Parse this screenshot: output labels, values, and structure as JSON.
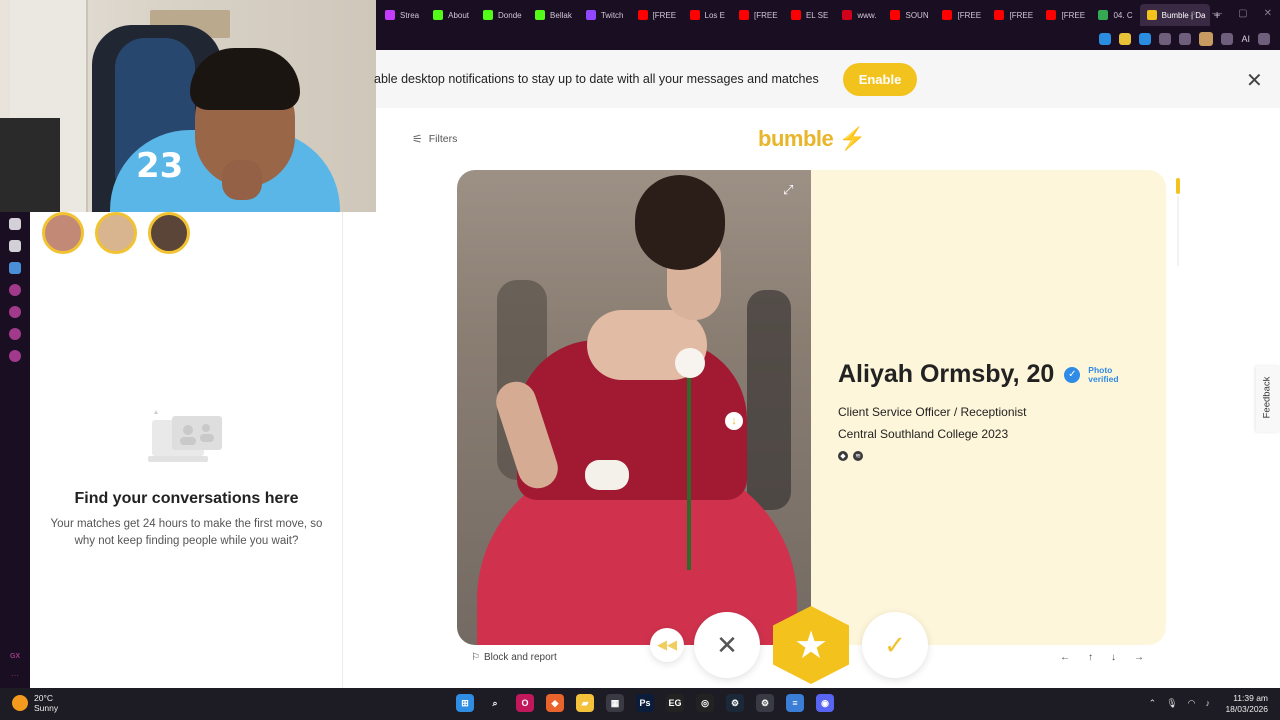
{
  "browser": {
    "tabs": [
      {
        "label": "Strea",
        "color": "#c63cff"
      },
      {
        "label": "About",
        "color": "#53fc18"
      },
      {
        "label": "Donde",
        "color": "#53fc18"
      },
      {
        "label": "Bellak",
        "color": "#53fc18"
      },
      {
        "label": "Twitch",
        "color": "#9146ff"
      },
      {
        "label": "[FREE",
        "color": "#ff0000"
      },
      {
        "label": "Los E",
        "color": "#ff0000"
      },
      {
        "label": "[FREE",
        "color": "#ff0000"
      },
      {
        "label": "EL SE",
        "color": "#ff0000"
      },
      {
        "label": "www.",
        "color": "#d0021b"
      },
      {
        "label": "SOUN",
        "color": "#ff0000"
      },
      {
        "label": "[FREE",
        "color": "#ff0000"
      },
      {
        "label": "[FREE",
        "color": "#ff0000"
      },
      {
        "label": "[FREE",
        "color": "#ff0000"
      },
      {
        "label": "04. C",
        "color": "#34a853"
      }
    ],
    "active_tab": {
      "label": "Bumble | Da",
      "color": "#f4c21c"
    },
    "new_tab_symbol": "+",
    "toolbar_ai_label": "AI"
  },
  "notification": {
    "text": "able desktop notifications to stay up to date with all your messages and matches",
    "enable_label": "Enable",
    "close_symbol": "✕"
  },
  "header": {
    "filters_label": "Filters",
    "logo_text": "bumble"
  },
  "matches": {
    "avatars": [
      {
        "color": "#c28a76"
      },
      {
        "color": "#d8b58f"
      },
      {
        "color": "#5b4538"
      }
    ]
  },
  "conversations": {
    "empty_title": "Find your conversations here",
    "empty_subtitle": "Your matches get 24 hours to make the first move, so why not keep finding people while you wait?"
  },
  "profile": {
    "name": "Aliyah Ormsby, 20",
    "verified_label": "Photo verified",
    "job": "Client Service Officer / Receptionist",
    "school": "Central Southland College 2023"
  },
  "actions": {
    "rewind_symbol": "◀◀",
    "pass_symbol": "✕",
    "superswipe_symbol": "★",
    "like_symbol": "✓"
  },
  "footer": {
    "block_report_label": "Block and report",
    "keyboard_hints": [
      "←",
      "↑",
      "↓",
      "→"
    ]
  },
  "feedback_label": "Feedback",
  "webcam": {
    "jersey_number": "23"
  },
  "sidebar": {
    "gx_label": "GX",
    "more_label": "···"
  },
  "taskbar": {
    "weather_temp": "20°C",
    "weather_desc": "Sunny",
    "time": "11:39 am",
    "date": "18/03/2026",
    "apps": [
      {
        "name": "windows",
        "color": "#2f8de4",
        "glyph": "⊞"
      },
      {
        "name": "search",
        "color": "transparent",
        "glyph": "⌕"
      },
      {
        "name": "opera-gx",
        "color": "#c2185b",
        "glyph": "O"
      },
      {
        "name": "brave",
        "color": "#e8642c",
        "glyph": "◆"
      },
      {
        "name": "explorer",
        "color": "#f3c13a",
        "glyph": "▰"
      },
      {
        "name": "store",
        "color": "#3a3a44",
        "glyph": "▦"
      },
      {
        "name": "photoshop",
        "color": "#0b1d3a",
        "glyph": "Ps"
      },
      {
        "name": "epic",
        "color": "#222",
        "glyph": "EG"
      },
      {
        "name": "obs",
        "color": "#222",
        "glyph": "◎"
      },
      {
        "name": "steam",
        "color": "#1b2838",
        "glyph": "⚙"
      },
      {
        "name": "settings",
        "color": "#3a3a44",
        "glyph": "⚙"
      },
      {
        "name": "notepad",
        "color": "#3b7ed8",
        "glyph": "≡"
      },
      {
        "name": "discord",
        "color": "#5865f2",
        "glyph": "◉"
      }
    ]
  }
}
